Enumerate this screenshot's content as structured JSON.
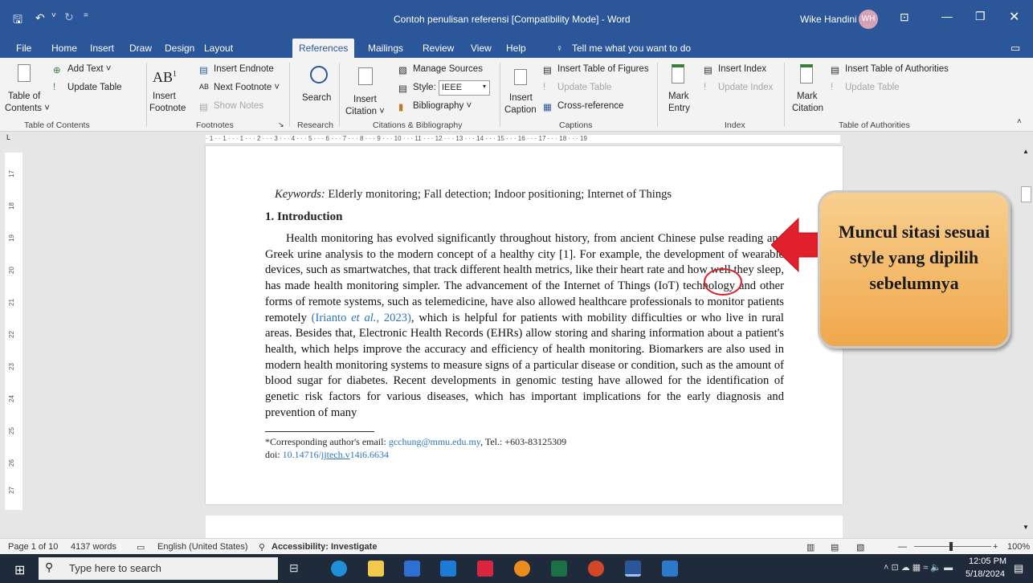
{
  "window": {
    "title": "Contoh penulisan referensi [Compatibility Mode]  -  Word",
    "user_name": "Wike Handini",
    "user_initials": "WH"
  },
  "tabs": [
    "File",
    "Home",
    "Insert",
    "Draw",
    "Design",
    "Layout",
    "References",
    "Mailings",
    "Review",
    "View",
    "Help"
  ],
  "tell_me": "Tell me what you want to do",
  "ribbon": {
    "toc": {
      "label": "Table of",
      "label2": "Contents ˅",
      "add_text": "Add Text ˅",
      "update_table": "Update Table",
      "group": "Table of Contents"
    },
    "footnotes": {
      "insert_footnote": "Insert",
      "insert_footnote2": "Footnote",
      "insert_endnote": "Insert Endnote",
      "next_footnote": "Next Footnote ˅",
      "show_notes": "Show Notes",
      "group": "Footnotes"
    },
    "research": {
      "search": "Search",
      "group": "Research"
    },
    "citations": {
      "insert_citation": "Insert",
      "insert_citation2": "Citation ˅",
      "manage_sources": "Manage Sources",
      "style_label": "Style:",
      "style_value": "IEEE",
      "bibliography": "Bibliography ˅",
      "group": "Citations & Bibliography"
    },
    "captions": {
      "insert_caption": "Insert",
      "insert_caption2": "Caption",
      "insert_tof": "Insert Table of Figures",
      "update_table": "Update Table",
      "cross_reference": "Cross-reference",
      "group": "Captions"
    },
    "index": {
      "mark_entry": "Mark",
      "mark_entry2": "Entry",
      "insert_index": "Insert Index",
      "update_index": "Update Index",
      "group": "Index"
    },
    "toa": {
      "mark_citation": "Mark",
      "mark_citation2": "Citation",
      "insert_toa": "Insert Table of Authorities",
      "update_table": "Update Table",
      "group": "Table of Authorities"
    }
  },
  "ruler": {
    "horizontal": "· 1 · · 1 · · · 1 · · · 2 · · · 3 · · · 4 · · · 5 · · · 6 · · · 7 · · · 8 · · · 9 · · · 10 · · · 11 · · · 12 · · · 13 · · · 14 · · · 15 · · · 16 · · · 17 · · · 18 · · · 19",
    "vertical": [
      "17",
      "18",
      "19",
      "20",
      "21",
      "22",
      "23",
      "24",
      "25",
      "26",
      "27"
    ]
  },
  "document": {
    "keywords_label": "Keywords:",
    "keywords": "Elderly monitoring; Fall detection; Indoor positioning; Internet of Things",
    "heading": "1.  Introduction",
    "para_part1": "Health monitoring has evolved significantly throughout history, from ancient Chinese pulse reading and Greek urine analysis to the modern concept of a healthy city [1]. For example, the development of wearable devices, such as smartwatches, that track different health metrics, like their heart rate and how well they sleep, has made health monitoring simpler. The advancement of the Internet of Things (IoT) technology and other forms of remote systems, such as telemedicine, have also allowed healthcare professionals to monitor patients remotely ",
    "citation_a": "(Irianto ",
    "citation_b": "et al.,",
    "citation_c": " 2023)",
    "para_part2": ", which is helpful for patients with mobility difficulties or who live in rural areas. Besides that, Electronic Health Records (EHRs) allow storing and sharing information about a patient's health, which helps improve the accuracy and efficiency of health monitoring. Biomarkers are also used in modern health monitoring systems to measure signs of a particular disease or condition, such as the amount of blood sugar for diabetes. Recent developments in genomic testing have allowed for the identification of genetic risk factors for various diseases, which has important implications for the early diagnosis and prevention of many",
    "footnote_label": "*Corresponding author's email: ",
    "footnote_email": "gcchung@mmu.edu.my",
    "footnote_tel": ", Tel.: +603-83125309",
    "doi_label": "doi: ",
    "doi_prefix": "10.14716/",
    "doi_link": "ijtech.v",
    "doi_suffix": "14i6.6634"
  },
  "callout": {
    "text": "Muncul sitasi sesuai style yang dipilih sebelumnya"
  },
  "status": {
    "page": "Page 1 of 10",
    "words": "4137 words",
    "language": "English (United States)",
    "accessibility": "Accessibility: Investigate",
    "zoom": "100%"
  },
  "taskbar": {
    "search_placeholder": "Type here to search",
    "time": "12:05 PM",
    "date": "5/18/2024"
  },
  "colors": {
    "word_blue": "#2b579a",
    "callout_fill": "#f0a84b",
    "arrow_red": "#e0202a",
    "link_blue": "#2e75b6"
  }
}
